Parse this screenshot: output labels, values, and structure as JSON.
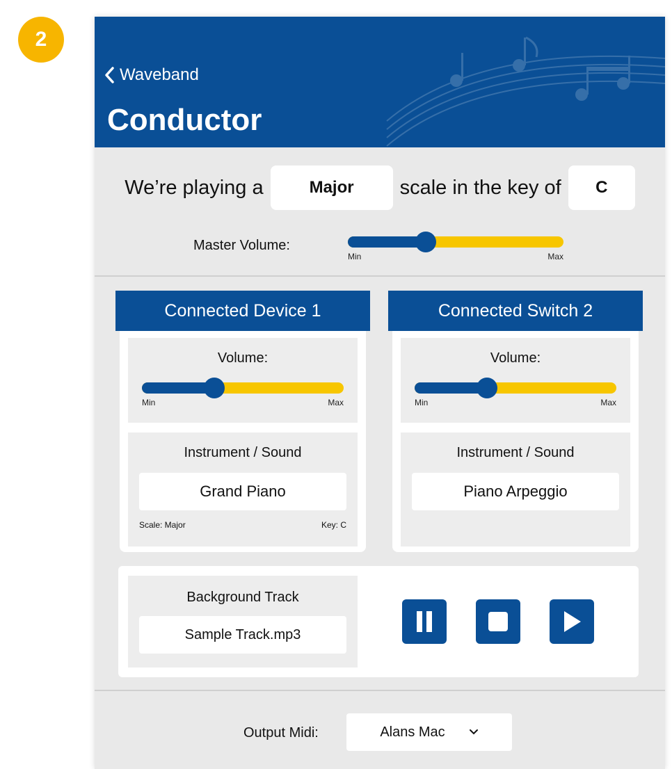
{
  "step_badge": "2",
  "header": {
    "back_label": "Waveband",
    "title": "Conductor"
  },
  "scale_row": {
    "prefix": "We’re playing a",
    "scale_value": "Major",
    "middle": "scale in the key of",
    "key_value": "C"
  },
  "master_volume": {
    "label": "Master Volume:",
    "level_fraction": 0.36,
    "min_label": "Min",
    "max_label": "Max"
  },
  "devices": [
    {
      "title": "Connected Device 1",
      "volume_label": "Volume:",
      "volume_fraction": 0.36,
      "min_label": "Min",
      "max_label": "Max",
      "instrument_label": "Instrument / Sound",
      "instrument_value": "Grand Piano",
      "scale_meta": "Scale: Major",
      "key_meta": "Key: C"
    },
    {
      "title": "Connected Switch 2",
      "volume_label": "Volume:",
      "volume_fraction": 0.36,
      "min_label": "Min",
      "max_label": "Max",
      "instrument_label": "Instrument / Sound",
      "instrument_value": "Piano Arpeggio"
    }
  ],
  "background_track": {
    "label": "Background Track",
    "value": "Sample Track.mp3",
    "controls": [
      "pause-icon",
      "stop-icon",
      "play-icon"
    ]
  },
  "output": {
    "label": "Output Midi:",
    "selected": "Alans Mac"
  },
  "colors": {
    "primary": "#0a4f96",
    "accent": "#f7c600",
    "badge": "#f7b500",
    "panel": "#e9e9e9"
  }
}
